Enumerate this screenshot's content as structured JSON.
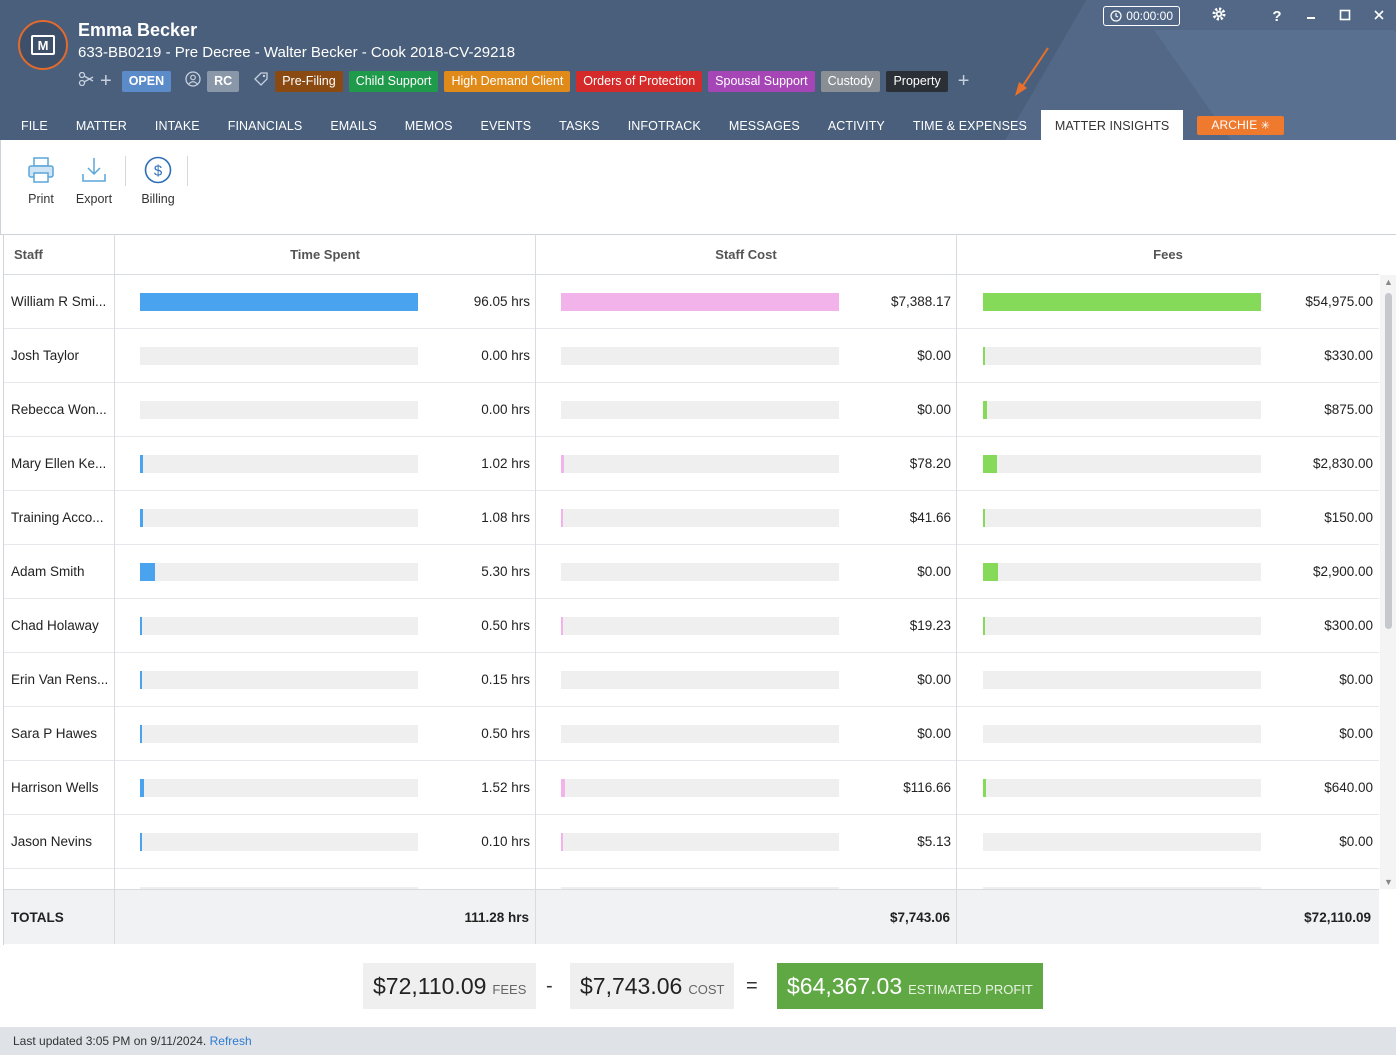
{
  "header": {
    "client_name": "Emma Becker",
    "matter_line": "633-BB0219 - Pre Decree - Walter Becker - Cook 2018-CV-29218",
    "status_badge": "OPEN",
    "initials_badge": "RC",
    "tags": [
      {
        "label": "Pre-Filing",
        "color": "#8a4a12"
      },
      {
        "label": "Child Support",
        "color": "#1f9a4a"
      },
      {
        "label": "High Demand Client",
        "color": "#e08a1a"
      },
      {
        "label": "Orders of Protection",
        "color": "#d42a2a"
      },
      {
        "label": "Spousal Support",
        "color": "#a646b6"
      },
      {
        "label": "Custody",
        "color": "#8a8f96"
      },
      {
        "label": "Property",
        "color": "#2b2f36"
      }
    ],
    "timer": "00:00:00",
    "help_label": "?",
    "icons": [
      "people-link-icon",
      "add-icon",
      "user-icon",
      "tag-icon",
      "gear-icon",
      "clock-icon"
    ]
  },
  "tabs": [
    {
      "label": "FILE",
      "active": false
    },
    {
      "label": "MATTER",
      "active": false
    },
    {
      "label": "INTAKE",
      "active": false
    },
    {
      "label": "FINANCIALS",
      "active": false
    },
    {
      "label": "EMAILS",
      "active": false
    },
    {
      "label": "MEMOS",
      "active": false
    },
    {
      "label": "EVENTS",
      "active": false
    },
    {
      "label": "TASKS",
      "active": false
    },
    {
      "label": "INFOTRACK",
      "active": false
    },
    {
      "label": "MESSAGES",
      "active": false
    },
    {
      "label": "ACTIVITY",
      "active": false
    },
    {
      "label": "TIME & EXPENSES",
      "active": false
    },
    {
      "label": "MATTER INSIGHTS",
      "active": true
    }
  ],
  "archie_label": "ARCHIE",
  "toolbar": {
    "print_label": "Print",
    "export_label": "Export",
    "billing_label": "Billing"
  },
  "table": {
    "columns": {
      "staff": "Staff",
      "time": "Time Spent",
      "cost": "Staff Cost",
      "fees": "Fees"
    },
    "colors": {
      "time": "#4aa3ee",
      "cost": "#f2b2ea",
      "fees": "#86da5a"
    },
    "rows": [
      {
        "name": "William R Smi...",
        "time": "96.05 hrs",
        "time_frac": 1.0,
        "cost": "$7,388.17",
        "cost_frac": 1.0,
        "fees": "$54,975.00",
        "fees_frac": 1.0
      },
      {
        "name": "Josh Taylor",
        "time": "0.00 hrs",
        "time_frac": 0.0,
        "cost": "$0.00",
        "cost_frac": 0.0,
        "fees": "$330.00",
        "fees_frac": 0.006
      },
      {
        "name": "Rebecca Won...",
        "time": "0.00 hrs",
        "time_frac": 0.0,
        "cost": "$0.00",
        "cost_frac": 0.0,
        "fees": "$875.00",
        "fees_frac": 0.016
      },
      {
        "name": "Mary Ellen Ke...",
        "time": "1.02 hrs",
        "time_frac": 0.011,
        "cost": "$78.20",
        "cost_frac": 0.011,
        "fees": "$2,830.00",
        "fees_frac": 0.051
      },
      {
        "name": "Training Acco...",
        "time": "1.08 hrs",
        "time_frac": 0.011,
        "cost": "$41.66",
        "cost_frac": 0.006,
        "fees": "$150.00",
        "fees_frac": 0.003
      },
      {
        "name": "Adam Smith",
        "time": "5.30 hrs",
        "time_frac": 0.055,
        "cost": "$0.00",
        "cost_frac": 0.0,
        "fees": "$2,900.00",
        "fees_frac": 0.053
      },
      {
        "name": "Chad Holaway",
        "time": "0.50 hrs",
        "time_frac": 0.005,
        "cost": "$19.23",
        "cost_frac": 0.003,
        "fees": "$300.00",
        "fees_frac": 0.005
      },
      {
        "name": "Erin Van Rens...",
        "time": "0.15 hrs",
        "time_frac": 0.0016,
        "cost": "$0.00",
        "cost_frac": 0.0,
        "fees": "$0.00",
        "fees_frac": 0.0
      },
      {
        "name": "Sara P Hawes",
        "time": "0.50 hrs",
        "time_frac": 0.005,
        "cost": "$0.00",
        "cost_frac": 0.0,
        "fees": "$0.00",
        "fees_frac": 0.0
      },
      {
        "name": "Harrison Wells",
        "time": "1.52 hrs",
        "time_frac": 0.016,
        "cost": "$116.66",
        "cost_frac": 0.016,
        "fees": "$640.00",
        "fees_frac": 0.012
      },
      {
        "name": "Jason Nevins",
        "time": "0.10 hrs",
        "time_frac": 0.001,
        "cost": "$5.13",
        "cost_frac": 0.0007,
        "fees": "$0.00",
        "fees_frac": 0.0
      },
      {
        "name": "",
        "time": "",
        "time_frac": 0.0,
        "cost": "",
        "cost_frac": 0.0,
        "fees": "",
        "fees_frac": 0.0
      }
    ],
    "totals": {
      "label": "TOTALS",
      "time": "111.28 hrs",
      "cost": "$7,743.06",
      "fees": "$72,110.09"
    }
  },
  "summary": {
    "fees_amount": "$72,110.09",
    "fees_label": "FEES",
    "minus": "-",
    "cost_amount": "$7,743.06",
    "cost_label": "COST",
    "equals": "=",
    "profit_amount": "$64,367.03",
    "profit_label": "ESTIMATED PROFIT"
  },
  "status": {
    "text": "Last updated 3:05 PM on 9/11/2024.",
    "refresh_label": "Refresh"
  }
}
